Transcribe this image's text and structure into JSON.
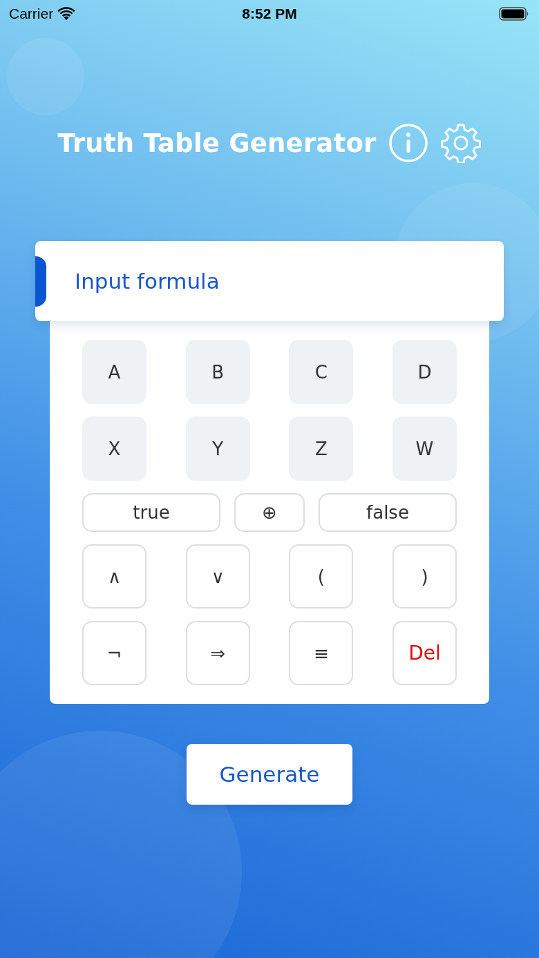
{
  "status_bar": {
    "carrier": "Carrier",
    "time": "8:52 PM"
  },
  "title": "Truth Table Generator",
  "formula_field": {
    "placeholder": "Input formula"
  },
  "keypad": [
    [
      {
        "label": "A",
        "kind": "filled"
      },
      {
        "label": "B",
        "kind": "filled"
      },
      {
        "label": "C",
        "kind": "filled"
      },
      {
        "label": "D",
        "kind": "filled"
      }
    ],
    [
      {
        "label": "X",
        "kind": "filled"
      },
      {
        "label": "Y",
        "kind": "filled"
      },
      {
        "label": "Z",
        "kind": "filled"
      },
      {
        "label": "W",
        "kind": "filled"
      }
    ],
    [
      {
        "label": "true",
        "kind": "wide"
      },
      {
        "label": "⊕",
        "kind": "narrow"
      },
      {
        "label": "false",
        "kind": "wide"
      }
    ],
    [
      {
        "label": "∧",
        "kind": "outlined"
      },
      {
        "label": "∨",
        "kind": "outlined"
      },
      {
        "label": "(",
        "kind": "outlined"
      },
      {
        "label": ")",
        "kind": "outlined"
      }
    ],
    [
      {
        "label": "¬",
        "kind": "outlined"
      },
      {
        "label": "⇒",
        "kind": "outlined"
      },
      {
        "label": "≡",
        "kind": "outlined"
      },
      {
        "label": "Del",
        "kind": "delete"
      }
    ]
  ],
  "generate_button": "Generate"
}
